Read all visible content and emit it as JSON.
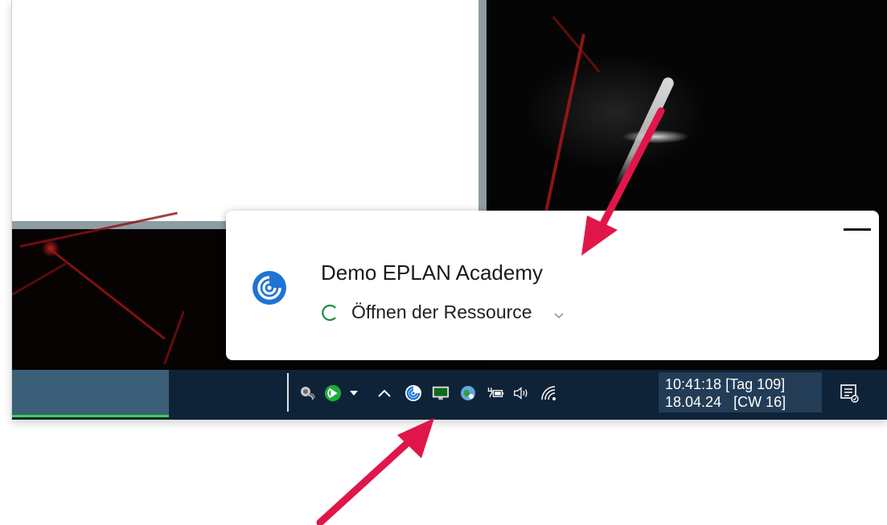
{
  "notification": {
    "app_name": "Demo EPLAN Academy",
    "status": "Öffnen der Ressource",
    "minimize_icon": "minimize-icon",
    "expand_icon": "chevron-down-icon",
    "app_icon": "eplan-academy-icon"
  },
  "taskbar": {
    "tray_icons": [
      "satellite-dish-icon",
      "play-circle-icon",
      "dropdown-triangle-icon",
      "chevron-up-icon",
      "eplan-academy-tray-icon",
      "monitor-icon",
      "globe-icon",
      "battery-plug-icon",
      "speaker-icon",
      "wifi-icon"
    ],
    "clock": {
      "line1": "10:41:18 [Tag 109]",
      "line2": "18.04.24   [CW 16]"
    },
    "notification_center_icon": "notification-center-icon"
  },
  "colors": {
    "accent_arrow": "#e0164a",
    "taskbar": "#0f2338",
    "active_indicator": "#39d353",
    "eplan_blue": "#1e73d6"
  }
}
